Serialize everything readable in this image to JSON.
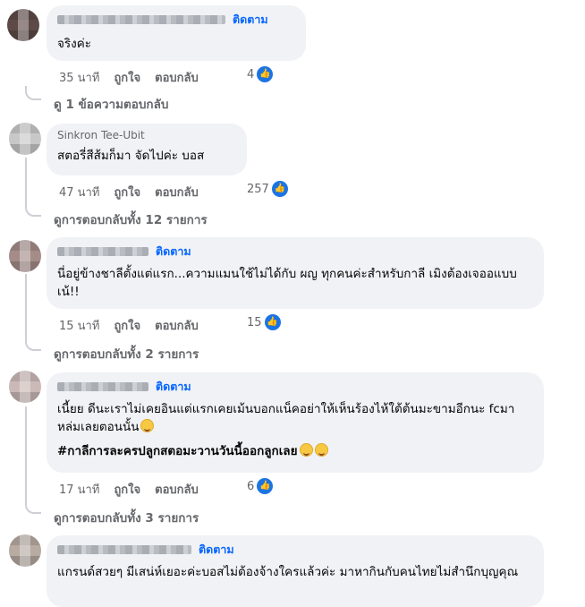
{
  "comments": [
    {
      "follow": "ติดตาม",
      "text": "จริงค่ะ",
      "time": "35 นาที",
      "like": "ถูกใจ",
      "reply": "ตอบกลับ",
      "reactions": "4",
      "view_replies": "ดู 1 ข้อความตอบกลับ"
    },
    {
      "name_partial": "Sinkron Tee-Ubit",
      "text": "สตอรี่สีส้มก็มา จัดไปค่ะ บอส",
      "time": "47 นาที",
      "like": "ถูกใจ",
      "reply": "ตอบกลับ",
      "reactions": "257",
      "view_replies": "ดูการตอบกลับทั้ง 12 รายการ"
    },
    {
      "follow": "ติดตาม",
      "text": "นี่อยู่ข้างชาลีตั้งแต่แรก...ความแมนใช้ไม่ได้กับ ผญ ทุกคนค่ะสำหรับกาลี เมิงต้องเจออแบบเน้!!",
      "time": "15 นาที",
      "like": "ถูกใจ",
      "reply": "ตอบกลับ",
      "reactions": "15",
      "view_replies": "ดูการตอบกลับทั้ง 2 รายการ"
    },
    {
      "follow": "ติดตาม",
      "text": "เนี้ยย ดีนะเราไม่เคยอินแต่แรกเคยเม้นบอกแน็คอย่าให้เห็นร้องไห้ใต้ต้นมะขามอีกนะ fcมาหล่มเลยตอนนั้น",
      "hashtag": "#กาลีการละครปลูกสตอมะวานวันนี้ออกลูกเลย",
      "time": "17 นาที",
      "like": "ถูกใจ",
      "reply": "ตอบกลับ",
      "reactions": "6",
      "view_replies": "ดูการตอบกลับทั้ง 3 รายการ"
    },
    {
      "follow": "ติดตาม",
      "text": "แกรนด์สวยๆ มีเสน่ห์เยอะค่ะบอสไม่ต้องจ้างใครแล้วค่ะ มาหากินกับคนไทยไม่สำนึกบุญคุณ"
    }
  ],
  "icons": {
    "like": "thumbs-up-icon",
    "emoji": "laughing-emoji-icon"
  },
  "colors": {
    "bubble": "#f0f2f5",
    "link": "#0866ff",
    "meta": "#65676b",
    "like_badge": "#1b74e4"
  }
}
